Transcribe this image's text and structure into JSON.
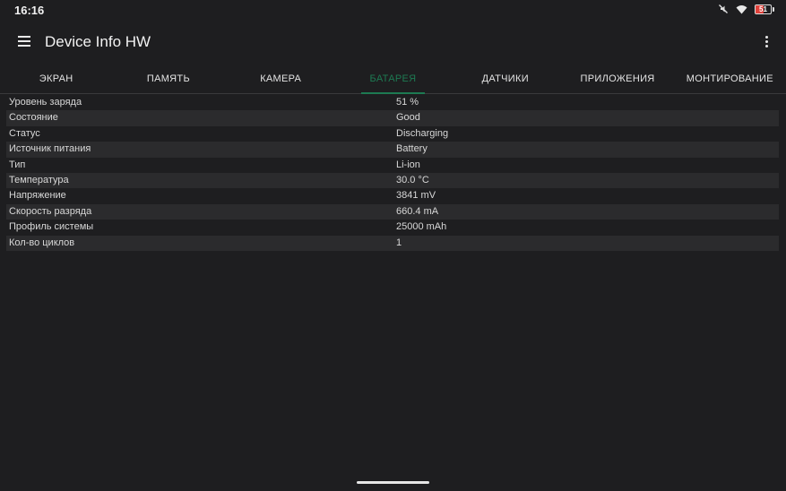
{
  "status_bar": {
    "time": "16:16",
    "battery_level": "51",
    "battery_fill_fraction": 0.51,
    "icons": [
      "mute-icon",
      "wifi-icon",
      "battery-icon"
    ],
    "battery_color": "#e0413a"
  },
  "app_bar": {
    "title": "Device Info HW",
    "menu_icon": "hamburger-menu-icon",
    "overflow_icon": "more-vert-icon"
  },
  "tabs": [
    {
      "label": "ЭКРАН",
      "active": false
    },
    {
      "label": "ПАМЯТЬ",
      "active": false
    },
    {
      "label": "КАМЕРА",
      "active": false
    },
    {
      "label": "БАТАРЕЯ",
      "active": true
    },
    {
      "label": "ДАТЧИКИ",
      "active": false
    },
    {
      "label": "ПРИЛОЖЕНИЯ",
      "active": false
    },
    {
      "label": "МОНТИРОВАНИЕ",
      "active": false
    }
  ],
  "accent_color": "#1d7a52",
  "battery_info": [
    {
      "key": "Уровень заряда",
      "value": "51 %"
    },
    {
      "key": "Состояние",
      "value": "Good"
    },
    {
      "key": "Статус",
      "value": "Discharging"
    },
    {
      "key": "Источник питания",
      "value": "Battery"
    },
    {
      "key": "Тип",
      "value": "Li-ion"
    },
    {
      "key": "Температура",
      "value": "30.0 °C"
    },
    {
      "key": "Напряжение",
      "value": "3841 mV"
    },
    {
      "key": "Скорость разряда",
      "value": "660.4 mA"
    },
    {
      "key": "Профиль системы",
      "value": "25000 mAh"
    },
    {
      "key": "Кол-во циклов",
      "value": "1"
    }
  ]
}
